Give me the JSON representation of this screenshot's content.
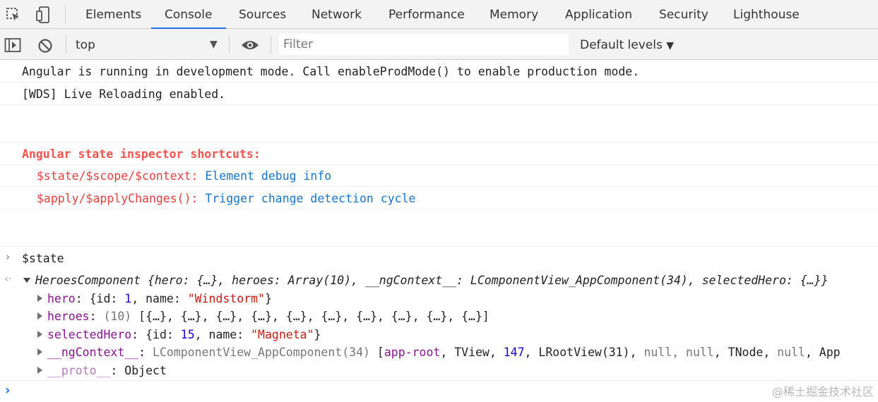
{
  "tabs": [
    {
      "label": "Elements"
    },
    {
      "label": "Console",
      "active": true
    },
    {
      "label": "Sources"
    },
    {
      "label": "Network"
    },
    {
      "label": "Performance"
    },
    {
      "label": "Memory"
    },
    {
      "label": "Application"
    },
    {
      "label": "Security"
    },
    {
      "label": "Lighthouse"
    }
  ],
  "toolbar": {
    "context": "top",
    "filter_placeholder": "Filter",
    "levels": "Default levels"
  },
  "messages": {
    "m1": "Angular is running in development mode. Call enableProdMode() to enable production mode.",
    "m2": "[WDS] Live Reloading enabled.",
    "inspector_title": "Angular state inspector shortcuts:",
    "shortcut1_key": "$state/$scope/$context:",
    "shortcut1_val": "Element debug info",
    "shortcut2_key": "$apply/$applyChanges():",
    "shortcut2_val": "Trigger change detection cycle"
  },
  "input_command": "$state",
  "result": {
    "summary": "HeroesComponent {hero: {…}, heroes: Array(10), __ngContext__: LComponentView_AppComponent(34), selectedHero: {…}}",
    "hero_key": "hero",
    "hero_val_pre": "{id: ",
    "hero_id": "1",
    "hero_val_mid": ", name: ",
    "hero_name": "\"Windstorm\"",
    "hero_val_post": "}",
    "heroes_key": "heroes",
    "heroes_count": "(10)",
    "heroes_val": "[{…}, {…}, {…}, {…}, {…}, {…}, {…}, {…}, {…}, {…}]",
    "selected_key": "selectedHero",
    "selected_pre": "{id: ",
    "selected_id": "15",
    "selected_mid": ", name: ",
    "selected_name": "\"Magneta\"",
    "selected_post": "}",
    "ngctx_key": "__ngContext__",
    "ngctx_type": "LComponentView_AppComponent(34)",
    "ngctx_open": "[",
    "ngctx_v1": "app-root",
    "ngctx_v2": ", TView, ",
    "ngctx_v3": "147",
    "ngctx_v4": ", LRootView(31), ",
    "ngctx_v5": "null, null",
    "ngctx_v6": ", TNode, ",
    "ngctx_v7": "null",
    "ngctx_v8": ", App",
    "proto_key": "__proto__",
    "proto_val": "Object"
  },
  "watermark": "@稀土掘金技术社区"
}
